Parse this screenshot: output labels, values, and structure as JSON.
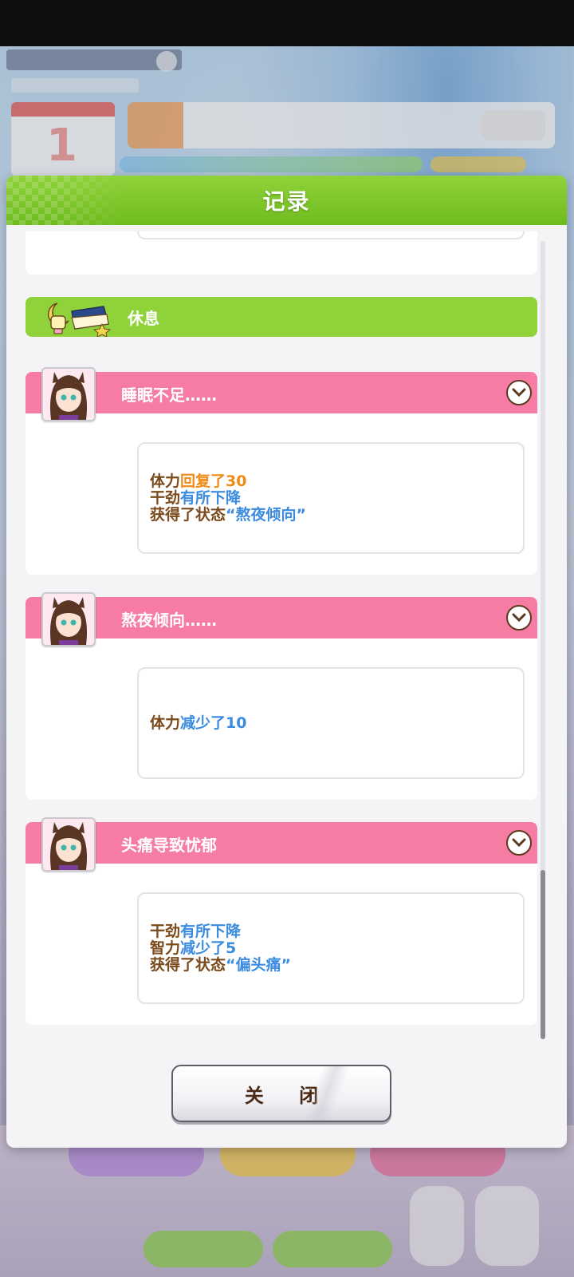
{
  "dialog": {
    "title": "记录",
    "close_label": "关 闭"
  },
  "category": {
    "label": "休息",
    "color": "#8fd23a"
  },
  "events": [
    {
      "title": "睡眠不足……",
      "lines": [
        [
          {
            "t": "体力",
            "c": "brown"
          },
          {
            "t": "回复了30",
            "c": "orange"
          }
        ],
        [
          {
            "t": "干劲",
            "c": "brown"
          },
          {
            "t": "有所下降",
            "c": "blue"
          }
        ],
        [
          {
            "t": "获得了状态",
            "c": "brown"
          },
          {
            "t": "“熬夜倾向”",
            "c": "blue"
          }
        ]
      ]
    },
    {
      "title": "熬夜倾向……",
      "lines": [
        [
          {
            "t": "体力",
            "c": "brown"
          },
          {
            "t": "减少了10",
            "c": "blue"
          }
        ]
      ]
    },
    {
      "title": "头痛导致忧郁",
      "lines": [
        [
          {
            "t": "干劲",
            "c": "brown"
          },
          {
            "t": "有所下降",
            "c": "blue"
          }
        ],
        [
          {
            "t": "智力",
            "c": "brown"
          },
          {
            "t": "减少了5",
            "c": "blue"
          }
        ],
        [
          {
            "t": "获得了状态",
            "c": "brown"
          },
          {
            "t": "“偏头痛”",
            "c": "blue"
          }
        ]
      ]
    }
  ],
  "colors": {
    "header_green": "#7cc52a",
    "event_pink": "#f67ca3",
    "text_brown": "#7a4a1c",
    "text_orange": "#f28a16",
    "text_blue": "#3b8be0"
  },
  "icons": {
    "category": "moon-lamp-pillow-icon",
    "event_toggle": "chevron-down-icon",
    "character": "character-portrait"
  }
}
